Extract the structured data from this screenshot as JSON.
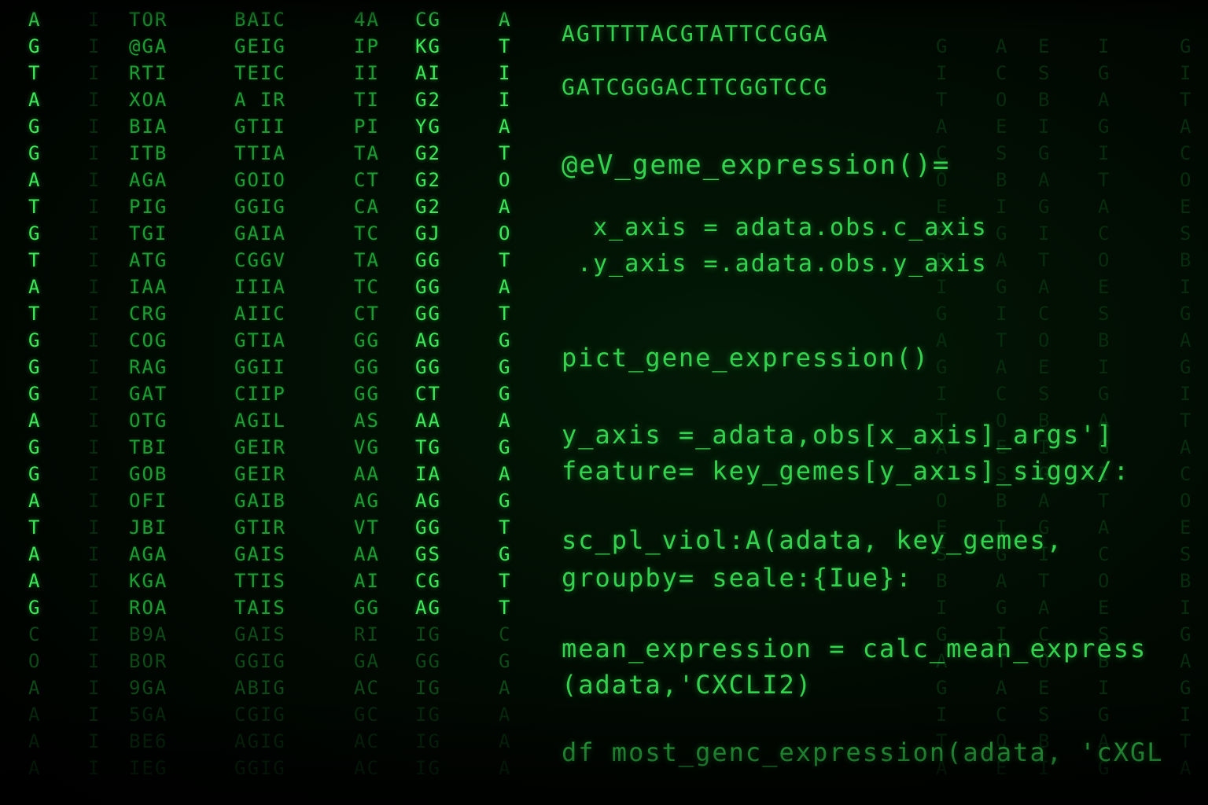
{
  "rain": {
    "columns": [
      {
        "tone": "bright",
        "glyphs": [
          "A",
          "G",
          "T",
          "A",
          "G",
          "G",
          "A",
          "T",
          "G",
          "T",
          "A",
          "T",
          "G",
          "G",
          "G",
          "A",
          "G",
          "G",
          "A",
          "T",
          "A",
          "A",
          "G",
          "C",
          "O",
          "A",
          "A",
          "A",
          "A"
        ]
      },
      {
        "tone": "faint",
        "glyphs": [
          "I",
          "I",
          "I",
          "I",
          "I",
          "I",
          "I",
          "I",
          "I",
          "I",
          "I",
          "I",
          "I",
          "I",
          "I",
          "I",
          "I",
          "I",
          "I",
          "I",
          "I",
          "I",
          "I",
          "I",
          "I",
          "I",
          "I",
          "I",
          "I"
        ]
      },
      {
        "tone": "mid",
        "glyphs": [
          "TOR",
          "@GA",
          "RTI",
          "XOA",
          "BIA",
          "ITB",
          "AGA",
          "PIG",
          "TGI",
          "ATG",
          "IAA",
          "CRG",
          "COG",
          "RAG",
          "GAT",
          "OTG",
          "TBI",
          "GOB",
          "OFI",
          "JBI",
          "AGA",
          "KGA",
          "ROA",
          "B9A",
          "BOR",
          "9GA",
          "5GA",
          "BE6",
          "IEG"
        ]
      },
      {
        "tone": "mid",
        "glyphs": [
          "BAIC",
          "GEIG",
          "TEIC",
          "A IR",
          "GTII",
          "TTIA",
          "GOIO",
          "GGIG",
          "GAIA",
          "CGGV",
          "IIIA",
          "AIIC",
          "GTIA",
          "GGII",
          "CIIP",
          "AGIL",
          "GEIR",
          "GEIR",
          "GAIB",
          "GTIR",
          "GAIS",
          "TTIS",
          "TAIS",
          "GAIS",
          "GGIG",
          "ABIG",
          "CGIG",
          "AGIG",
          "GGIG"
        ]
      },
      {
        "tone": "mid",
        "glyphs": [
          "4A",
          "IP",
          "II",
          "TI",
          "PI",
          "TA",
          "CT",
          "CA",
          "TC",
          "TA",
          "TC",
          "CT",
          "GG",
          "GG",
          "GG",
          "AS",
          "VG",
          "AA",
          "AG",
          "VT",
          "AA",
          "AI",
          "GG",
          "RI",
          "GA",
          "AC",
          "GC",
          "AC",
          "AC"
        ]
      },
      {
        "tone": "bright",
        "glyphs": [
          "CG",
          "KG",
          "AI",
          "G2",
          "YG",
          "G2",
          "G2",
          "G2",
          "GJ",
          "GG",
          "GG",
          "GG",
          "AG",
          "GG",
          "CT",
          "AA",
          "TG",
          "IA",
          "AG",
          "GG",
          "GS",
          "CG",
          "AG",
          "IG",
          "GG",
          "IG",
          "IG",
          "IG",
          "IG"
        ]
      },
      {
        "tone": "bright",
        "glyphs": [
          "A",
          "T",
          "I",
          "I",
          "A",
          "T",
          "O",
          "A",
          "O",
          "T",
          "A",
          "T",
          "G",
          "G",
          "G",
          "A",
          "G",
          "A",
          "G",
          "T",
          "G",
          "T",
          "T",
          "C",
          "G",
          "A",
          "A",
          "A",
          "A"
        ]
      }
    ]
  },
  "code": {
    "lines": [
      {
        "text": "AGTTTTACGTATTCCGGA",
        "size": 28
      },
      {
        "text": "GATCGGGACITCGGTCCG",
        "size": 28
      },
      {
        "text": "@eV_geme_expression()=",
        "size": 34
      },
      {
        "text": "  x_axis = adata.obs.c_axis",
        "size": 30
      },
      {
        "text": " .y_axis =.adata.obs.y_axis",
        "size": 30
      },
      {
        "text": "pict_gene_expression()",
        "size": 32
      },
      {
        "text": "y_axis =_adata,obs[x_axis]_args']",
        "size": 32
      },
      {
        "text": "feature= key_gemes[y_axıs]_siggx/:",
        "size": 32
      },
      {
        "text": "sc_pl_viol:A(adata, key_gemes,",
        "size": 32
      },
      {
        "text": "groupby= seale:{Iue}:",
        "size": 32
      },
      {
        "text": "mean_expression = calc_mean_express",
        "size": 32
      },
      {
        "text": "(adata,'CXCLI2)",
        "size": 32
      },
      {
        "text": "df most_genc_expression(adata, 'cXGL",
        "size": 32
      }
    ]
  }
}
